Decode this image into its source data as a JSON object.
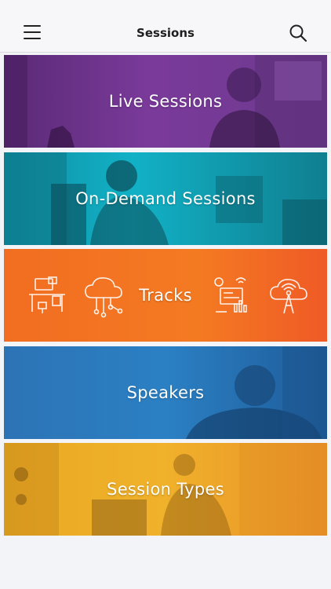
{
  "header": {
    "title": "Sessions",
    "menu_icon": "hamburger-menu-icon",
    "search_icon": "search-icon"
  },
  "tiles": [
    {
      "label": "Live Sessions",
      "color": "#7a3a9a"
    },
    {
      "label": "On-Demand Sessions",
      "color": "#12b1c6"
    },
    {
      "label": "Tracks",
      "color": "#f47a22"
    },
    {
      "label": "Speakers",
      "color": "#2e8ad0"
    },
    {
      "label": "Session Types",
      "color": "#f0b12b"
    }
  ]
}
